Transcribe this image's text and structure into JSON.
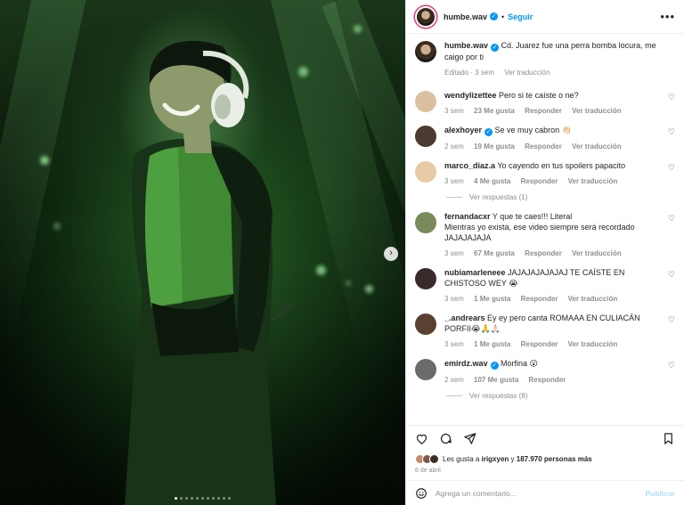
{
  "post": {
    "author": "humbe.wav",
    "follow_label": "Seguir",
    "caption": "Cd. Juarez fue una perra bomba locura, me caigo por ti",
    "caption_meta": {
      "edited": "Editado",
      "time": "3 sem",
      "translate": "Ver traducción"
    },
    "carousel": {
      "slides": 11,
      "active": 0
    }
  },
  "comments": [
    {
      "user": "wendylizettee",
      "verified": false,
      "text": "Pero si te caíste o ne?",
      "time": "3 sem",
      "likes": "23 Me gusta",
      "reply": "Responder",
      "translate": "Ver traducción",
      "avatar_color": "#d9c1a0"
    },
    {
      "user": "alexhoyer",
      "verified": true,
      "text": "Se ve muy cabron 👏🏻",
      "time": "2 sem",
      "likes": "19 Me gusta",
      "reply": "Responder",
      "translate": "Ver traducción",
      "avatar_color": "#4a3a30"
    },
    {
      "user": "marco_diaz.a",
      "verified": false,
      "text": "Yo cayendo en tus spoilers papacito",
      "time": "3 sem",
      "likes": "4 Me gusta",
      "reply": "Responder",
      "translate": "Ver traducción",
      "avatar_color": "#e7cba4",
      "replies": "Ver respuestas (1)"
    },
    {
      "user": "fernandacxr",
      "verified": false,
      "text": "Y que te caes!!! Literal\nMientras yo exista, ese video siempre será recordado JAJAJAJAJA",
      "time": "3 sem",
      "likes": "67 Me gusta",
      "reply": "Responder",
      "translate": "Ver traducción",
      "avatar_color": "#7a8a5a"
    },
    {
      "user": "nubiamarleneee",
      "verified": false,
      "text": "JAJAJAJAJAJAJ TE CAÍSTE EN CHISTOSO WEY 😭",
      "time": "3 sem",
      "likes": "1 Me gusta",
      "reply": "Responder",
      "translate": "Ver traducción",
      "avatar_color": "#3b2a2a"
    },
    {
      "user": "_.andrears",
      "verified": false,
      "text": "Ey ey pero canta ROMAAA EN CULIACÁN PORFII😭🙏🙏🏻",
      "time": "3 sem",
      "likes": "1 Me gusta",
      "reply": "Responder",
      "translate": "Ver traducción",
      "avatar_color": "#5a4030"
    },
    {
      "user": "emirdz.wav",
      "verified": true,
      "text": "Morfina 😮",
      "time": "2 sem",
      "likes": "107 Me gusta",
      "reply": "Responder",
      "translate": "",
      "avatar_color": "#6b6b6b",
      "replies": "Ver respuestas (8)"
    }
  ],
  "footer": {
    "likes_prefix": "Les gusta a",
    "likes_user": "irigxyen",
    "likes_mid": "y",
    "likes_count": "187.970 personas más",
    "date": "6 de abril",
    "comment_placeholder": "Agrega un comentario...",
    "publish_label": "Publicar"
  },
  "colors": {
    "accent": "#0095f6",
    "story_ring": "#e1306c",
    "stage_green": "#2f6a2a"
  }
}
